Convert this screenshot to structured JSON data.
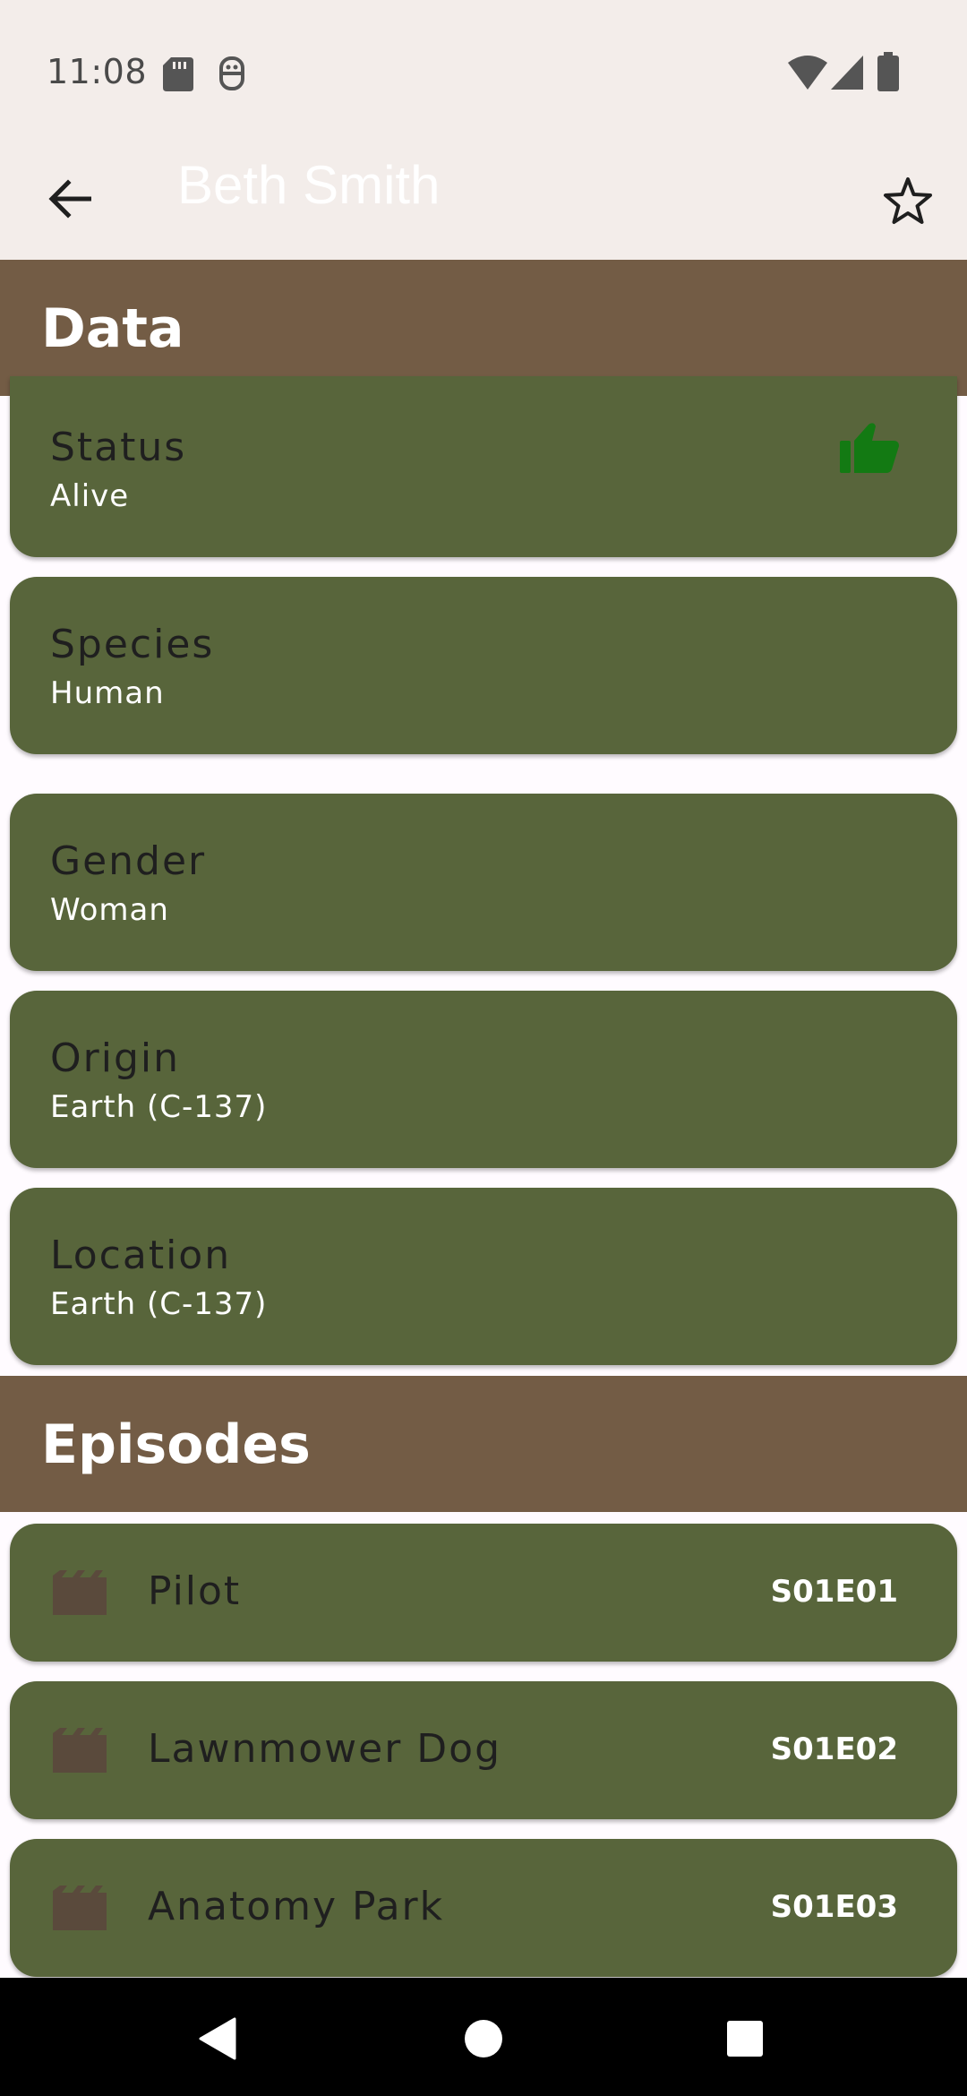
{
  "status_bar": {
    "time": "11:08"
  },
  "app_bar": {
    "title": "Beth Smith"
  },
  "sections": {
    "data_title": "Data",
    "episodes_title": "Episodes"
  },
  "fields": [
    {
      "label": "Status",
      "value": "Alive"
    },
    {
      "label": "Species",
      "value": "Human"
    },
    {
      "label": "Gender",
      "value": "Woman"
    },
    {
      "label": "Origin",
      "value": "Earth (C-137)"
    },
    {
      "label": "Location",
      "value": "Earth (C-137)"
    }
  ],
  "episodes": [
    {
      "name": "Pilot",
      "code": "S01E01"
    },
    {
      "name": "Lawnmower Dog",
      "code": "S01E02"
    },
    {
      "name": "Anatomy Park",
      "code": "S01E03"
    }
  ],
  "icons": {
    "back": "arrow-back-icon",
    "favorite": "star-outline-icon",
    "status": "thumb-up-icon",
    "episode": "movie-clapper-icon"
  },
  "colors": {
    "app_bar_bg": "#f3edea",
    "section_header_bg": "#735c45",
    "card_bg": "#58653b",
    "status_alive": "#137a13",
    "episode_icon": "#5a4a3c"
  }
}
